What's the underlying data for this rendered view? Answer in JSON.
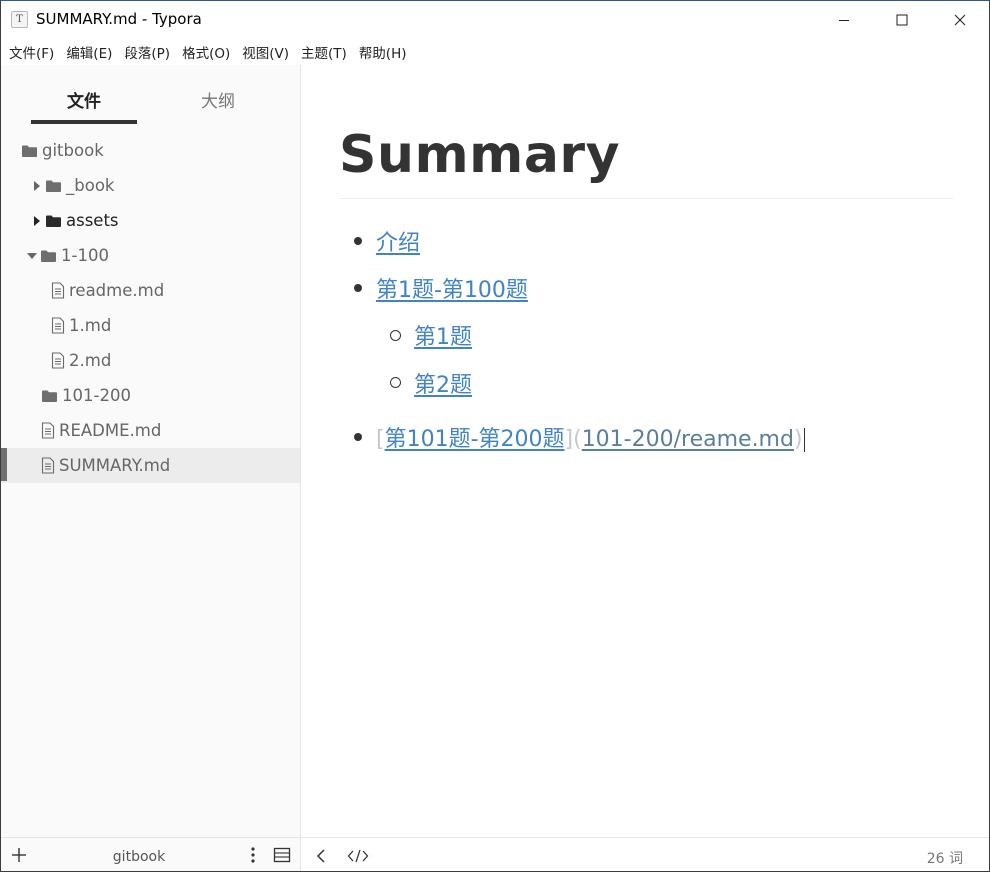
{
  "window": {
    "title": "SUMMARY.md - Typora",
    "app_icon_letter": "T"
  },
  "menu": [
    {
      "label": "文件(F)"
    },
    {
      "label": "编辑(E)"
    },
    {
      "label": "段落(P)"
    },
    {
      "label": "格式(O)"
    },
    {
      "label": "视图(V)"
    },
    {
      "label": "主题(T)"
    },
    {
      "label": "帮助(H)"
    }
  ],
  "sidebar": {
    "tabs": {
      "files": "文件",
      "outline": "大纲",
      "active": "files"
    },
    "tree": [
      {
        "label": "gitbook",
        "kind": "folder",
        "depth": 0,
        "caret": "none",
        "dark": false
      },
      {
        "label": "_book",
        "kind": "folder",
        "depth": 1,
        "caret": "right",
        "dark": false
      },
      {
        "label": "assets",
        "kind": "folder",
        "depth": 1,
        "caret": "right",
        "dark": true
      },
      {
        "label": "1-100",
        "kind": "folder",
        "depth": 1,
        "caret": "down",
        "dark": false
      },
      {
        "label": "readme.md",
        "kind": "file",
        "depth": 2,
        "caret": "none",
        "dark": false
      },
      {
        "label": "1.md",
        "kind": "file",
        "depth": 2,
        "caret": "none",
        "dark": false
      },
      {
        "label": "2.md",
        "kind": "file",
        "depth": 2,
        "caret": "none",
        "dark": false
      },
      {
        "label": "101-200",
        "kind": "folder",
        "depth": 1,
        "caret": "none",
        "dark": false
      },
      {
        "label": "README.md",
        "kind": "file",
        "depth": 1,
        "caret": "none",
        "dark": false
      },
      {
        "label": "SUMMARY.md",
        "kind": "file",
        "depth": 1,
        "caret": "none",
        "dark": false,
        "selected": true
      }
    ],
    "footer": {
      "folder_name": "gitbook"
    }
  },
  "document": {
    "heading": "Summary",
    "items": {
      "intro": "介绍",
      "range1": "第1题-第100题",
      "q1": "第1题",
      "q2": "第2题",
      "range2_open": "[",
      "range2_text": "第101题-第200题",
      "range2_mid": "](",
      "range2_url": "101-200/reame.md",
      "range2_close": ")"
    }
  },
  "statusbar": {
    "word_count": "26 词"
  },
  "colors": {
    "link": "#4183c4",
    "text": "#333333",
    "sidebar_bg": "#fafafa",
    "selected_row": "#ececec"
  }
}
